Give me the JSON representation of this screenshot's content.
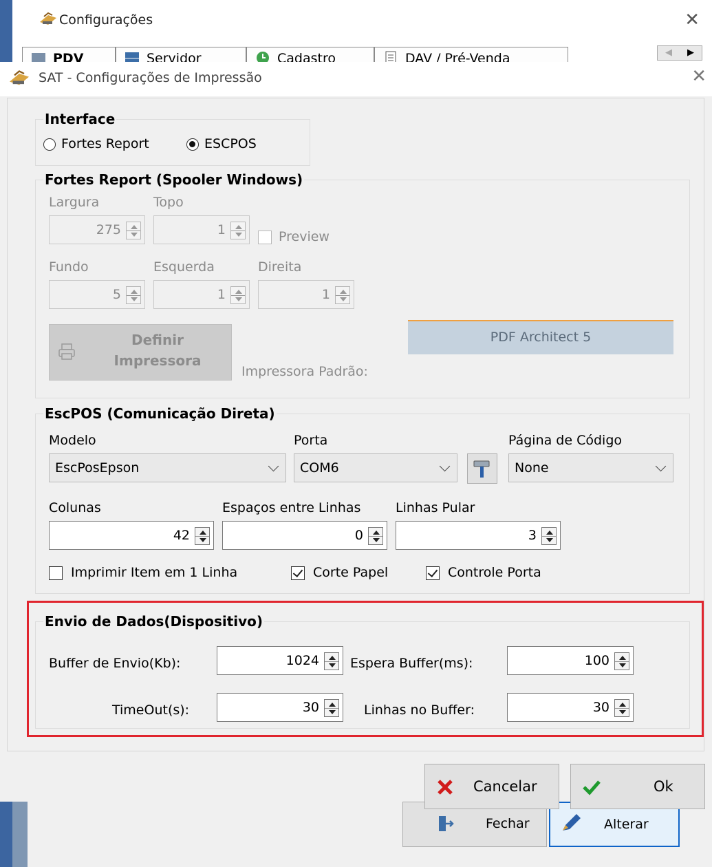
{
  "background_window": {
    "title": "Configurações",
    "tabs": [
      "PDV",
      "Servidor",
      "Cadastro",
      "DAV / Pré-Venda"
    ],
    "buttons": {
      "close": "Fechar",
      "edit": "Alterar"
    }
  },
  "dialog": {
    "title": "SAT - Configurações de Impressão",
    "interface": {
      "title": "Interface",
      "options": [
        "Fortes Report",
        "ESCPOS"
      ],
      "selected": "ESCPOS"
    },
    "fortes": {
      "title": "Fortes Report (Spooler Windows)",
      "largura": {
        "label": "Largura",
        "value": "275"
      },
      "topo": {
        "label": "Topo",
        "value": "1"
      },
      "preview": {
        "label": "Preview",
        "checked": false
      },
      "fundo": {
        "label": "Fundo",
        "value": "5"
      },
      "esquerda": {
        "label": "Esquerda",
        "value": "1"
      },
      "direita": {
        "label": "Direita",
        "value": "1"
      },
      "define_printer": {
        "line1": "Definir",
        "line2": "Impressora"
      },
      "default_printer_label": "Impressora Padrão:",
      "default_printer_value": "PDF Architect 5"
    },
    "escpos": {
      "title": "EscPOS (Comunicação Direta)",
      "modelo": {
        "label": "Modelo",
        "value": "EscPosEpson"
      },
      "porta": {
        "label": "Porta",
        "value": "COM6"
      },
      "pagina": {
        "label": "Página de Código",
        "value": "None"
      },
      "colunas": {
        "label": "Colunas",
        "value": "42"
      },
      "espacos": {
        "label": "Espaços entre Linhas",
        "value": "0"
      },
      "linhas_pular": {
        "label": "Linhas Pular",
        "value": "3"
      },
      "imprimir_item": {
        "label": "Imprimir Item em 1 Linha",
        "checked": false
      },
      "corte_papel": {
        "label": "Corte Papel",
        "checked": true
      },
      "controle_porta": {
        "label": "Controle Porta",
        "checked": true
      }
    },
    "envio": {
      "title": "Envio de Dados(Dispositivo)",
      "buffer_envio": {
        "label": "Buffer de Envio(Kb):",
        "value": "1024"
      },
      "espera_buffer": {
        "label": "Espera Buffer(ms):",
        "value": "100"
      },
      "timeout": {
        "label": "TimeOut(s):",
        "value": "30"
      },
      "linhas_buffer": {
        "label": "Linhas no Buffer:",
        "value": "30"
      }
    },
    "buttons": {
      "cancel": "Cancelar",
      "ok": "Ok"
    }
  },
  "colors": {
    "highlight": "#e0252e",
    "ok_check": "#1f9a2e",
    "cancel_x": "#d11a1a",
    "focus": "#0f64c8"
  }
}
